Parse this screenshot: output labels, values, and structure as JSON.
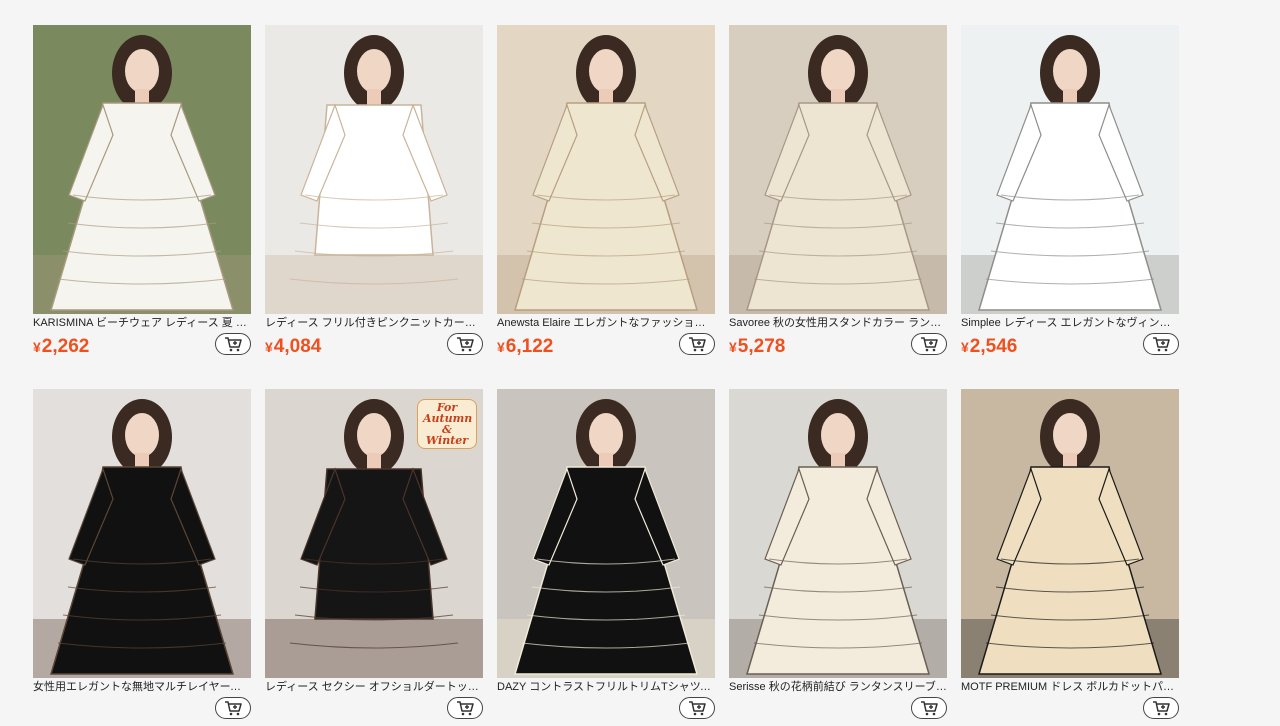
{
  "products": [
    {
      "title": "KARISMINA ビーチウェア レディース 夏 バカンス ワンピース",
      "price": "2,262",
      "currency": "¥",
      "bg": "#7b8a5e",
      "fg": "#f6f4ef",
      "accent": "#a89a80"
    },
    {
      "title": "レディース フリル付きピンクニットカーディガン 甘め",
      "price": "4,084",
      "currency": "¥",
      "bg": "#ebe9e6",
      "fg": "#ffffff",
      "accent": "#c9b49b"
    },
    {
      "title": "Anewsta Elaire エレガントなファッションプリーツドレス",
      "price": "6,122",
      "currency": "¥",
      "bg": "#e3d7c3",
      "fg": "#efe6cf",
      "accent": "#b79f82"
    },
    {
      "title": "Savoree 秋の女性用スタンドカラー ランタンスリーブ",
      "price": "5,278",
      "currency": "¥",
      "bg": "#d8cebf",
      "fg": "#eee4d2",
      "accent": "#a79786"
    },
    {
      "title": "Simplee レディース エレガントなヴィンテージレースドレス",
      "price": "2,546",
      "currency": "¥",
      "bg": "#eef1f2",
      "fg": "#ffffff",
      "accent": "#8e8e8a"
    },
    {
      "title": "女性用エレガントな無地マルチレイヤーフリル/ベルスリーブ",
      "price": "",
      "currency": "¥",
      "bg": "#e2dfdc",
      "fg": "#111111",
      "accent": "#5b4636"
    },
    {
      "title": "レディース セクシー オフショルダートップ ストレッチ",
      "price": "",
      "currency": "¥",
      "bg": "#dcd6d1",
      "fg": "#151515",
      "accent": "#4a3429",
      "badge": "For Autumn & Winter"
    },
    {
      "title": "DAZY コントラストフリルトリムTシャツ、秋服レディース",
      "price": "",
      "currency": "¥",
      "bg": "#c9c4bd",
      "fg": "#111111",
      "accent": "#f1ead8"
    },
    {
      "title": "Serisse 秋の花柄前結び ランタンスリーブブラウス",
      "price": "",
      "currency": "¥",
      "bg": "#d9d8d3",
      "fg": "#f3ecdc",
      "accent": "#6a5f55"
    },
    {
      "title": "MOTF PREMIUM ドレス ボルカドットパターン",
      "price": "",
      "currency": "¥",
      "bg": "#c8b8a2",
      "fg": "#efdfc0",
      "accent": "#1b1b1b"
    }
  ],
  "icons": {
    "cart": "add-to-cart-icon"
  },
  "colors": {
    "price": "#f0501e",
    "background": "#f5f5f5"
  }
}
